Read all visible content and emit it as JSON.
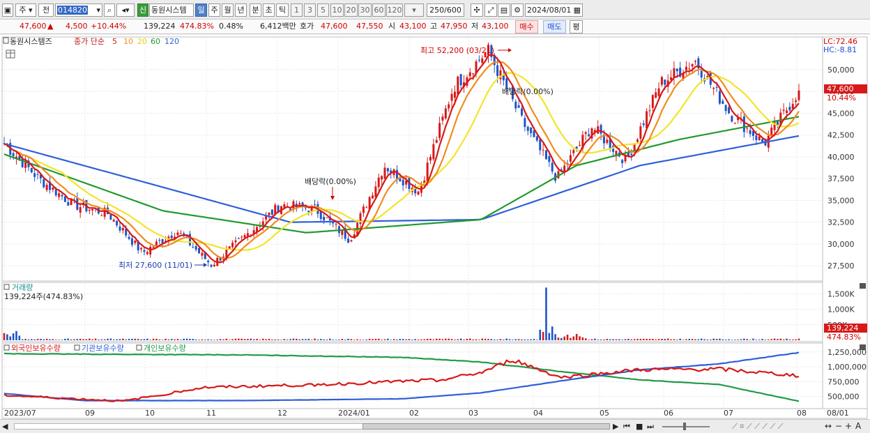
{
  "toolbar": {
    "main_menu": "주",
    "prev_label": "전",
    "code": "014820",
    "new_badge": "신",
    "stock_name": "동원시스템",
    "period_tabs": [
      "일",
      "주",
      "월",
      "년",
      "분",
      "초",
      "틱"
    ],
    "active_period": "일",
    "interval_buttons": [
      "1",
      "3",
      "5",
      "10",
      "20",
      "30",
      "60",
      "120"
    ],
    "count_value": "250",
    "count_total": "/600",
    "date": "2024/08/01"
  },
  "quote": {
    "price": "47,600",
    "up_arrow": "▲",
    "change": "4,500",
    "change_pct": "+10.44%",
    "volume": "139,224",
    "vol_ratio": "474.83%",
    "turnover_pct": "0.48%",
    "amount": "6,412백만",
    "bidask_label": "호가",
    "ask_price": "47,600",
    "bid_price": "47,550",
    "open_label": "시",
    "open": "43,100",
    "high_label": "고",
    "high": "47,950",
    "low_label": "저",
    "low": "43,100",
    "buy_label": "매수",
    "sell_label": "매도",
    "eval_label": "평"
  },
  "price_panel": {
    "legend_name": "동원시스템즈",
    "legend_ma_label": "종가 단순",
    "ma_periods": [
      "5",
      "10",
      "20",
      "60",
      "120"
    ],
    "ma_colors": [
      "#d71919",
      "#f08c1e",
      "#f2e52a",
      "#22992e",
      "#2f5fd8"
    ],
    "lc_label": "LC:72.46",
    "hc_label": "HC:-8.81",
    "current_price_tag": "47,600",
    "current_pct_tag": "10.44%",
    "annotation_high": "최고 52,200 (03/21)",
    "annotation_low": "최저 27,600 (11/01)",
    "annotation_div1": "배당락(0.00%)",
    "annotation_div2": "배당락(0.00%)",
    "y_ticks": [
      "50,000",
      "47,500",
      "45,000",
      "42,500",
      "40,000",
      "37,500",
      "35,000",
      "32,500",
      "30,000",
      "27,500"
    ],
    "colors": {
      "up": "#d71919",
      "down": "#1e54c8"
    }
  },
  "volume_panel": {
    "title": "거래량",
    "value_label": "139,224주(474.83%)",
    "y_ticks": [
      "1,500K",
      "1,000K",
      "500K"
    ],
    "current_tag": "139,224",
    "current_pct_tag": "474.83%"
  },
  "holdings_panel": {
    "legends": [
      "외국인보유수량",
      "기관보유수량",
      "개인보유수량"
    ],
    "colors": [
      "#d71919",
      "#2f5fd8",
      "#22994a"
    ],
    "y_ticks": [
      "1,250,000",
      "1,000,000",
      "750,000",
      "500,000"
    ]
  },
  "x_axis": {
    "labels": [
      "2023/07",
      "09",
      "10",
      "11",
      "12",
      "2024/01",
      "02",
      "03",
      "04",
      "05",
      "06",
      "07",
      "08",
      "08/01"
    ]
  },
  "chart_data": {
    "type": "candlestick",
    "x_range": [
      "2023/07",
      "2024/08/01"
    ],
    "ylim": [
      26000,
      53500
    ],
    "anchors": [
      {
        "date": "2023/07",
        "close": 41500
      },
      {
        "date": "2023/07 end",
        "close": 37500
      },
      {
        "date": "08",
        "close": 34500
      },
      {
        "date": "09",
        "close": 33500
      },
      {
        "date": "10",
        "close": 29000
      },
      {
        "date": "10 mid",
        "close": 31500
      },
      {
        "date": "11/01",
        "close": 27600
      },
      {
        "date": "11",
        "close": 31000
      },
      {
        "date": "12",
        "close": 34500
      },
      {
        "date": "2024/01",
        "close": 34000
      },
      {
        "date": "02",
        "close": 30500
      },
      {
        "date": "02 end",
        "close": 39000
      },
      {
        "date": "03",
        "close": 36000
      },
      {
        "date": "03 mid",
        "close": 48000
      },
      {
        "date": "03/21",
        "close": 52200
      },
      {
        "date": "04",
        "close": 44000
      },
      {
        "date": "04 mid",
        "close": 37500
      },
      {
        "date": "05",
        "close": 43500
      },
      {
        "date": "06",
        "close": 39500
      },
      {
        "date": "06 mid",
        "close": 48500
      },
      {
        "date": "07",
        "close": 51000
      },
      {
        "date": "07 mid",
        "close": 45000
      },
      {
        "date": "07 end",
        "close": 41500
      },
      {
        "date": "08/01",
        "close": 47600
      }
    ],
    "ma_anchors": {
      "ma120": [
        [
          0,
          41500
        ],
        [
          0.36,
          32500
        ],
        [
          0.6,
          32800
        ],
        [
          0.8,
          39000
        ],
        [
          1.0,
          42400
        ]
      ],
      "ma60": [
        [
          0,
          40300
        ],
        [
          0.2,
          33800
        ],
        [
          0.38,
          31300
        ],
        [
          0.6,
          32800
        ],
        [
          0.72,
          39000
        ],
        [
          0.85,
          42000
        ],
        [
          1.0,
          44600
        ]
      ]
    },
    "holdings": {
      "foreign": [
        [
          0,
          520000
        ],
        [
          0.15,
          420000
        ],
        [
          0.25,
          650000
        ],
        [
          0.4,
          700000
        ],
        [
          0.55,
          780000
        ],
        [
          0.6,
          900000
        ],
        [
          0.64,
          1120000
        ],
        [
          0.7,
          820000
        ],
        [
          0.8,
          950000
        ],
        [
          0.9,
          960000
        ],
        [
          1.0,
          850000
        ]
      ],
      "institution": [
        [
          0,
          550000
        ],
        [
          0.1,
          430000
        ],
        [
          0.3,
          430000
        ],
        [
          0.5,
          460000
        ],
        [
          0.6,
          560000
        ],
        [
          0.7,
          760000
        ],
        [
          0.8,
          950000
        ],
        [
          0.9,
          1050000
        ],
        [
          1.0,
          1240000
        ]
      ],
      "individual": [
        [
          0,
          1220000
        ],
        [
          0.3,
          1200000
        ],
        [
          0.5,
          1160000
        ],
        [
          0.6,
          1080000
        ],
        [
          0.7,
          920000
        ],
        [
          0.8,
          780000
        ],
        [
          0.9,
          700000
        ],
        [
          1.0,
          420000
        ]
      ]
    }
  }
}
